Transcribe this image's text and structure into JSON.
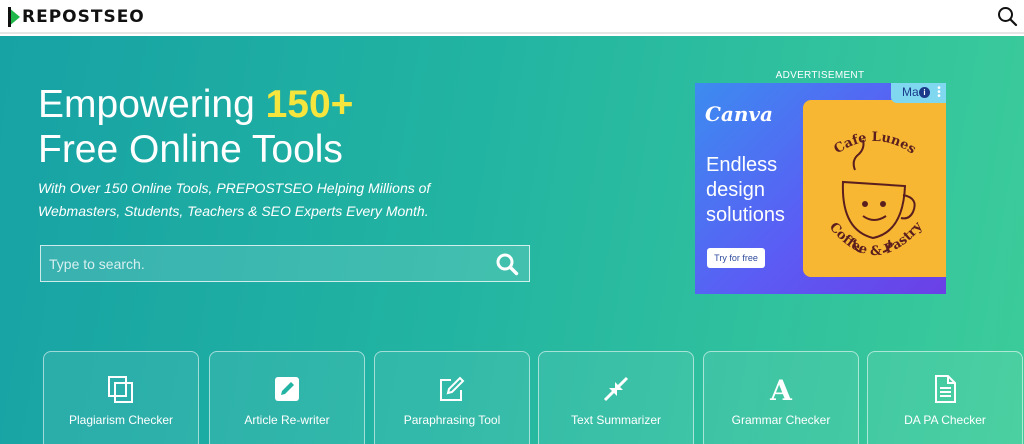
{
  "brand": {
    "logo_text": "REPOSTSEO",
    "logo_full_name": "PREPOSTSEO",
    "accent_green": "#1fb74a",
    "hero_gradient": [
      "#17a2a4",
      "#3ccc9a"
    ],
    "highlight_color": "#f5e53c"
  },
  "navbar": {
    "search_icon": "search-icon"
  },
  "hero": {
    "title_prefix": "Empowering ",
    "title_highlight": "150+",
    "title_line2": "Free Online Tools",
    "subtitle": "With Over 150 Online Tools, PREPOSTSEO Helping Millions of Webmasters, Students, Teachers & SEO Experts Every Month.",
    "search": {
      "placeholder": "Type to search.",
      "value": "",
      "icon": "search-icon"
    }
  },
  "advertisement": {
    "label": "ADVERTISEMENT",
    "brand": "Canva",
    "headline_lines": [
      "Endless",
      "design",
      "solutions"
    ],
    "cta": "Try for free",
    "badge_text": "Ma",
    "card_text_top": "Cafe Lunes",
    "card_text_bottom": "Coffee & Pastry"
  },
  "tools": [
    {
      "label": "Plagiarism Checker",
      "icon": "copy-icon"
    },
    {
      "label": "Article Re-writer",
      "icon": "edit-square-icon"
    },
    {
      "label": "Paraphrasing Tool",
      "icon": "pencil-square-icon"
    },
    {
      "label": "Text Summarizer",
      "icon": "compress-arrows-icon"
    },
    {
      "label": "Grammar Checker",
      "icon": "letter-a-icon"
    },
    {
      "label": "DA PA Checker",
      "icon": "document-icon"
    }
  ]
}
